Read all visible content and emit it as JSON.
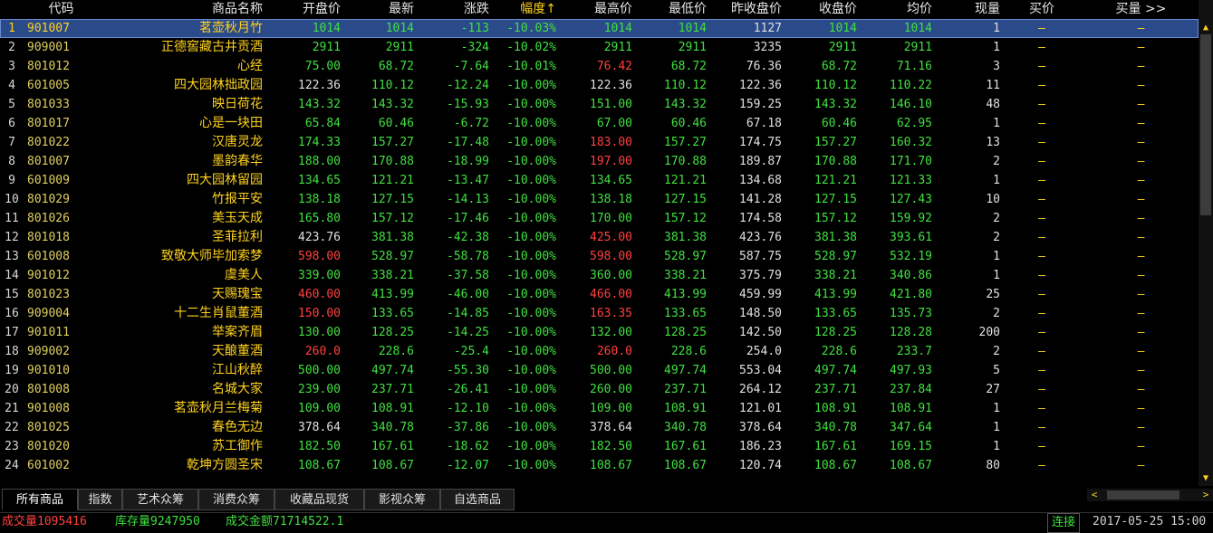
{
  "header": {
    "cols": [
      "代码",
      "商品名称",
      "开盘价",
      "最新",
      "涨跌",
      "幅度↑",
      "最高价",
      "最低价",
      "昨收盘价",
      "收盘价",
      "均价",
      "现量",
      "买价",
      "买量 >>"
    ]
  },
  "rows": [
    [
      "1",
      "901007",
      "茗壶秋月竹",
      "1014",
      "1014",
      "-113",
      "-10.03%",
      "1014",
      "1014",
      "1127",
      "1014",
      "1014",
      "1",
      "—",
      "—"
    ],
    [
      "2",
      "909001",
      "正德窖藏古井贡酒",
      "2911",
      "2911",
      "-324",
      "-10.02%",
      "2911",
      "2911",
      "3235",
      "2911",
      "2911",
      "1",
      "—",
      "—"
    ],
    [
      "3",
      "801012",
      "心经",
      "75.00",
      "68.72",
      "-7.64",
      "-10.01%",
      "76.42",
      "68.72",
      "76.36",
      "68.72",
      "71.16",
      "3",
      "—",
      "—"
    ],
    [
      "4",
      "601005",
      "四大园林拙政园",
      "122.36",
      "110.12",
      "-12.24",
      "-10.00%",
      "122.36",
      "110.12",
      "122.36",
      "110.12",
      "110.22",
      "11",
      "—",
      "—"
    ],
    [
      "5",
      "801033",
      "映日荷花",
      "143.32",
      "143.32",
      "-15.93",
      "-10.00%",
      "151.00",
      "143.32",
      "159.25",
      "143.32",
      "146.10",
      "48",
      "—",
      "—"
    ],
    [
      "6",
      "801017",
      "心是一块田",
      "65.84",
      "60.46",
      "-6.72",
      "-10.00%",
      "67.00",
      "60.46",
      "67.18",
      "60.46",
      "62.95",
      "1",
      "—",
      "—"
    ],
    [
      "7",
      "801022",
      "汉唐灵龙",
      "174.33",
      "157.27",
      "-17.48",
      "-10.00%",
      "183.00",
      "157.27",
      "174.75",
      "157.27",
      "160.32",
      "13",
      "—",
      "—"
    ],
    [
      "8",
      "801007",
      "墨韵春华",
      "188.00",
      "170.88",
      "-18.99",
      "-10.00%",
      "197.00",
      "170.88",
      "189.87",
      "170.88",
      "171.70",
      "2",
      "—",
      "—"
    ],
    [
      "9",
      "601009",
      "四大园林留园",
      "134.65",
      "121.21",
      "-13.47",
      "-10.00%",
      "134.65",
      "121.21",
      "134.68",
      "121.21",
      "121.33",
      "1",
      "—",
      "—"
    ],
    [
      "10",
      "801029",
      "竹报平安",
      "138.18",
      "127.15",
      "-14.13",
      "-10.00%",
      "138.18",
      "127.15",
      "141.28",
      "127.15",
      "127.43",
      "10",
      "—",
      "—"
    ],
    [
      "11",
      "801026",
      "美玉天成",
      "165.80",
      "157.12",
      "-17.46",
      "-10.00%",
      "170.00",
      "157.12",
      "174.58",
      "157.12",
      "159.92",
      "2",
      "—",
      "—"
    ],
    [
      "12",
      "801018",
      "圣菲拉利",
      "423.76",
      "381.38",
      "-42.38",
      "-10.00%",
      "425.00",
      "381.38",
      "423.76",
      "381.38",
      "393.61",
      "2",
      "—",
      "—"
    ],
    [
      "13",
      "601008",
      "致敬大师毕加索梦",
      "598.00",
      "528.97",
      "-58.78",
      "-10.00%",
      "598.00",
      "528.97",
      "587.75",
      "528.97",
      "532.19",
      "1",
      "—",
      "—"
    ],
    [
      "14",
      "901012",
      "虞美人",
      "339.00",
      "338.21",
      "-37.58",
      "-10.00%",
      "360.00",
      "338.21",
      "375.79",
      "338.21",
      "340.86",
      "1",
      "—",
      "—"
    ],
    [
      "15",
      "801023",
      "天赐瑰宝",
      "460.00",
      "413.99",
      "-46.00",
      "-10.00%",
      "466.00",
      "413.99",
      "459.99",
      "413.99",
      "421.80",
      "25",
      "—",
      "—"
    ],
    [
      "16",
      "909004",
      "十二生肖鼠董酒",
      "150.00",
      "133.65",
      "-14.85",
      "-10.00%",
      "163.35",
      "133.65",
      "148.50",
      "133.65",
      "135.73",
      "2",
      "—",
      "—"
    ],
    [
      "17",
      "901011",
      "举案齐眉",
      "130.00",
      "128.25",
      "-14.25",
      "-10.00%",
      "132.00",
      "128.25",
      "142.50",
      "128.25",
      "128.28",
      "200",
      "—",
      "—"
    ],
    [
      "18",
      "909002",
      "天酿董酒",
      "260.0",
      "228.6",
      "-25.4",
      "-10.00%",
      "260.0",
      "228.6",
      "254.0",
      "228.6",
      "233.7",
      "2",
      "—",
      "—"
    ],
    [
      "19",
      "901010",
      "江山秋醉",
      "500.00",
      "497.74",
      "-55.30",
      "-10.00%",
      "500.00",
      "497.74",
      "553.04",
      "497.74",
      "497.93",
      "5",
      "—",
      "—"
    ],
    [
      "20",
      "801008",
      "名城大家",
      "239.00",
      "237.71",
      "-26.41",
      "-10.00%",
      "260.00",
      "237.71",
      "264.12",
      "237.71",
      "237.84",
      "27",
      "—",
      "—"
    ],
    [
      "21",
      "901008",
      "茗壶秋月兰梅菊",
      "109.00",
      "108.91",
      "-12.10",
      "-10.00%",
      "109.00",
      "108.91",
      "121.01",
      "108.91",
      "108.91",
      "1",
      "—",
      "—"
    ],
    [
      "22",
      "801025",
      "春色无边",
      "378.64",
      "340.78",
      "-37.86",
      "-10.00%",
      "378.64",
      "340.78",
      "378.64",
      "340.78",
      "347.64",
      "1",
      "—",
      "—"
    ],
    [
      "23",
      "801020",
      "苏工御作",
      "182.50",
      "167.61",
      "-18.62",
      "-10.00%",
      "182.50",
      "167.61",
      "186.23",
      "167.61",
      "169.15",
      "1",
      "—",
      "—"
    ],
    [
      "24",
      "601002",
      "乾坤方圆圣宋",
      "108.67",
      "108.67",
      "-12.07",
      "-10.00%",
      "108.67",
      "108.67",
      "120.74",
      "108.67",
      "108.67",
      "80",
      "—",
      "—"
    ]
  ],
  "tabs": [
    "所有商品",
    "指数",
    "艺术众筹",
    "消费众筹",
    "收藏品现货",
    "影视众筹",
    "自选商品"
  ],
  "status": {
    "volume_label": "成交量",
    "volume": "1095416",
    "stock_label": "库存量",
    "stock": "9247950",
    "amount_label": "成交金额",
    "amount": "71714522.1",
    "connection": "连接",
    "datetime": "2017-05-25 15:00"
  },
  "scroll": {
    "up": "▲",
    "down": "▼",
    "left": "<",
    "right": ">"
  },
  "colors": {
    "up": "#ff4040",
    "down": "#40e040",
    "flat": "#e0e0e0",
    "name": "#ffd21e",
    "selected_bg": "#2a4a8a"
  }
}
